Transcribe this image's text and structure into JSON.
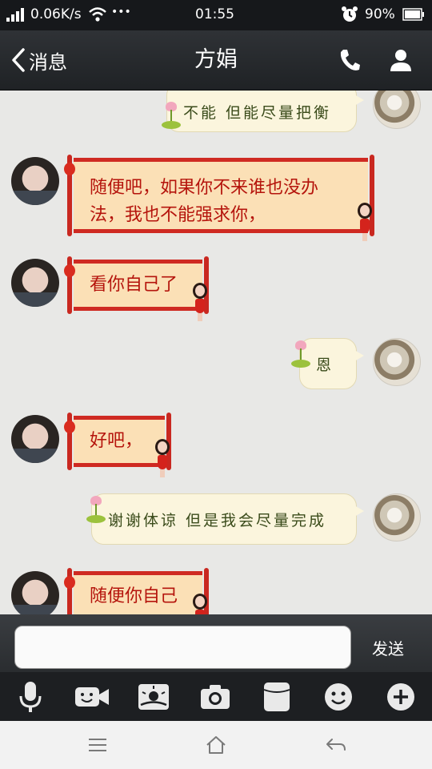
{
  "status_bar": {
    "network_speed": "0.06K/s",
    "more_dots": "•••",
    "time": "01:55",
    "battery_percent": "90%",
    "icons": [
      "signal-icon",
      "wifi-icon",
      "alarm-icon",
      "battery-icon"
    ]
  },
  "nav": {
    "back_label": "消息",
    "title": "方娟",
    "icons": [
      "chevron-left-icon",
      "phone-icon",
      "profile-icon"
    ]
  },
  "messages": [
    {
      "from": "me",
      "text": "不能 但能尽量把衡"
    },
    {
      "from": "contact",
      "lines": [
        "随便吧，如果你不来谁也没办",
        "法，我也不能强求你，"
      ]
    },
    {
      "from": "contact",
      "lines": [
        "看你自己了"
      ]
    },
    {
      "from": "me",
      "text": "恩"
    },
    {
      "from": "contact",
      "lines": [
        "好吧，"
      ]
    },
    {
      "from": "me",
      "text": "谢谢体谅 但是我会尽量完成"
    },
    {
      "from": "contact",
      "lines": [
        "随便你自己"
      ]
    }
  ],
  "composer": {
    "input_value": "",
    "send_label": "发送"
  },
  "toolbar": {
    "icons": [
      "microphone-icon",
      "video-call-icon",
      "gallery-icon",
      "camera-icon",
      "card-icon",
      "emoji-icon",
      "plus-icon"
    ]
  },
  "system_nav": {
    "icons": [
      "menu-icon",
      "home-icon",
      "back-icon"
    ]
  },
  "colors": {
    "chat_background": "#e8e8e6",
    "contact_scroll_fill": "#fbe0b6",
    "contact_scroll_border": "#cf2a22",
    "contact_text": "#b5140c",
    "my_bubble_fill": "#fbf5dd",
    "my_text": "#3a4b1a"
  }
}
